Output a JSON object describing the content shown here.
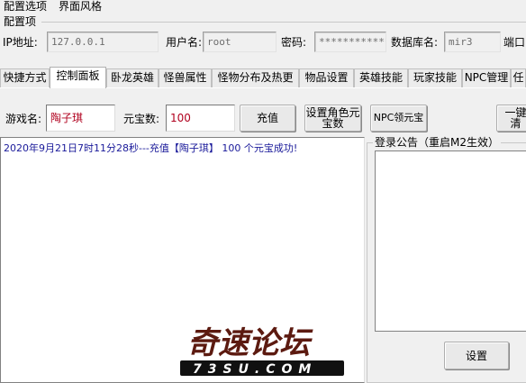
{
  "menubar": {
    "items": [
      "配置选项",
      "界面风格"
    ]
  },
  "config": {
    "group_label": "配置项",
    "ip_label": "IP地址:",
    "ip_value": "127.0.0.1",
    "user_label": "用户名:",
    "user_value": "root",
    "pwd_label": "密码:",
    "pwd_value": "*************",
    "db_label": "数据库名:",
    "db_value": "mir3",
    "port_label": "端口"
  },
  "tabs": [
    {
      "label": "快捷方式",
      "active": false
    },
    {
      "label": "控制面板",
      "active": true
    },
    {
      "label": "卧龙英雄",
      "active": false
    },
    {
      "label": "怪兽属性",
      "active": false
    },
    {
      "label": "怪物分布及热更",
      "active": false
    },
    {
      "label": "物品设置",
      "active": false
    },
    {
      "label": "英雄技能",
      "active": false
    },
    {
      "label": "玩家技能",
      "active": false
    },
    {
      "label": "NPC管理",
      "active": false
    },
    {
      "label": "任",
      "active": false
    }
  ],
  "panel": {
    "game_name_label": "游戏名:",
    "game_name_value": "陶子琪",
    "yuanbao_label": "元宝数:",
    "yuanbao_value": "100",
    "recharge_button": "充值",
    "set_role_button_line1": "设置角色元",
    "set_role_button_line2": "宝数",
    "npc_button": "NPC领元宝",
    "one_key_button": "一键清",
    "log_line": "2020年9月21日7时11分28秒---充值【陶子琪】 100 个元宝成功!",
    "notice_title": "登录公告（重启M2生效）",
    "settings_button": "设置"
  },
  "watermark": {
    "title": "奇速论坛",
    "subtitle": "73SU.COM"
  },
  "colors": {
    "input_text": "#b0001e",
    "log_text": "#1a1a9a",
    "field_text": "#6d6d6d",
    "watermark_main": "#5c1a10",
    "watermark_outline": "#ffffff"
  }
}
